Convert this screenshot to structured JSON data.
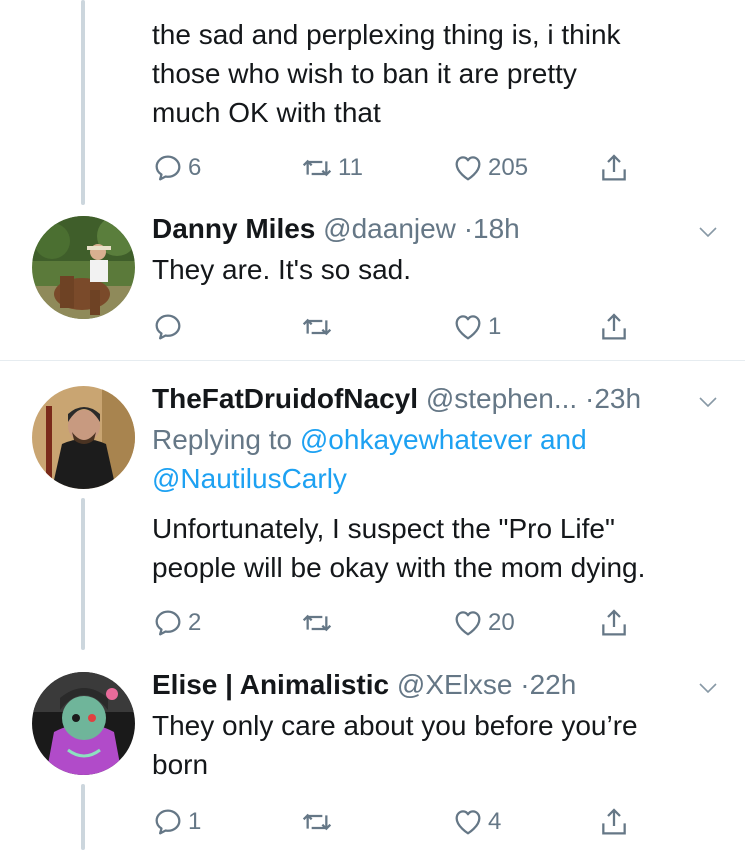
{
  "tweets": [
    {
      "text_lines": [
        "the sad and perplexing thing is, i think",
        "those who wish to ban it are pretty",
        "much OK with that"
      ],
      "actions": {
        "reply": "6",
        "retweet": "11",
        "like": "205"
      }
    },
    {
      "name": "Danny Miles",
      "handle": "@daanjew",
      "sep": "·",
      "time": "18h",
      "text_lines": [
        "They are. It's so sad."
      ],
      "actions": {
        "reply": "",
        "retweet": "",
        "like": "1"
      }
    },
    {
      "name": "TheFatDruidofNacyl",
      "handle": "@stephen...",
      "sep": "·",
      "time": "23h",
      "replying_prefix": "Replying to",
      "replying_user1": "@ohkayewhatever",
      "replying_and": "and",
      "replying_user2": "@NautilusCarly",
      "text_lines": [
        "Unfortunately, I suspect the \"Pro Life\"",
        "people will be okay with the mom dying."
      ],
      "actions": {
        "reply": "2",
        "retweet": "",
        "like": "20"
      }
    },
    {
      "name": "Elise | Animalistic",
      "handle": "@XElxse",
      "sep": "·",
      "time": "22h",
      "text_lines": [
        "They only care about you before you’re",
        "born"
      ],
      "actions": {
        "reply": "1",
        "retweet": "",
        "like": "4"
      }
    }
  ],
  "colors": {
    "text": "#14171a",
    "muted": "#657786",
    "link": "#1da1f2",
    "thread_line": "#ccd6dd",
    "divider": "#e6ecf0"
  },
  "icons": [
    "reply-icon",
    "retweet-icon",
    "like-icon",
    "share-icon",
    "chevron-down-icon"
  ]
}
